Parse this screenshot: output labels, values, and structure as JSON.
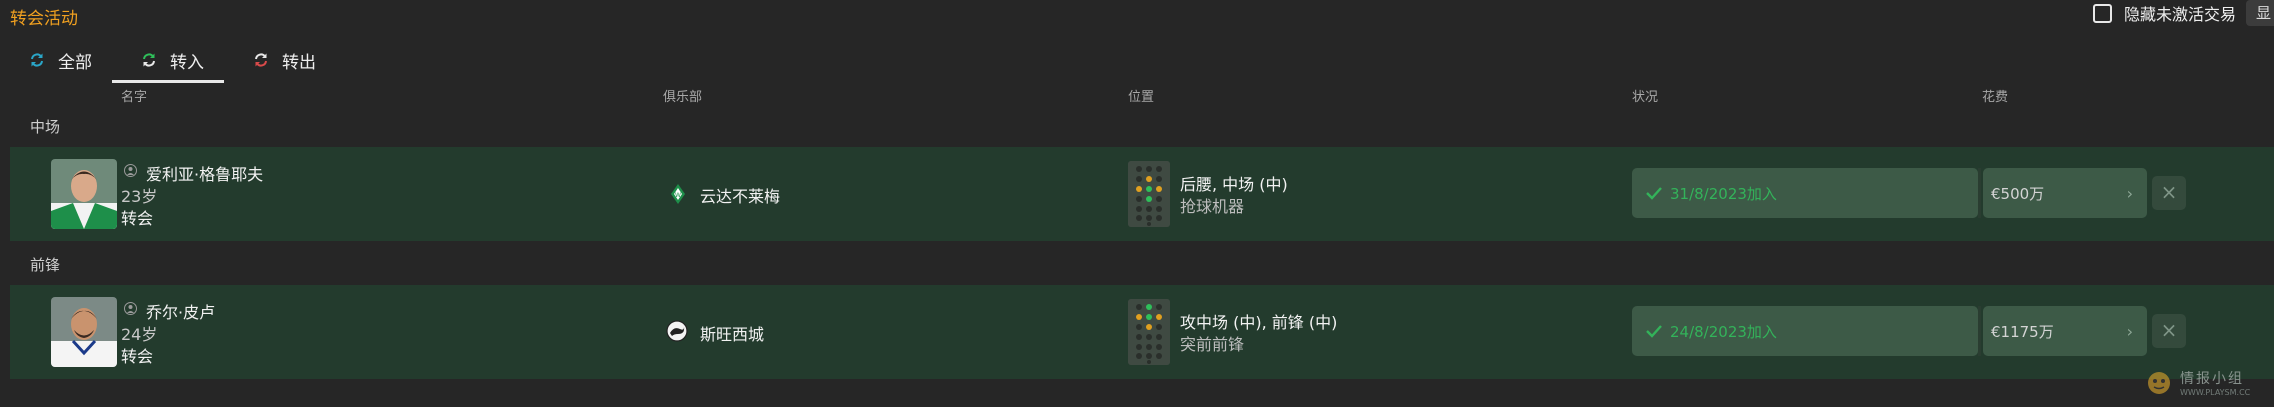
{
  "header": {
    "title": "转会活动",
    "hide_inactive_label": "隐藏未激活交易",
    "corner_button": "显"
  },
  "tabs": [
    {
      "label": "全部",
      "icon": "refresh-icon",
      "color": "#2aa6c8"
    },
    {
      "label": "转入",
      "icon": "transfer-in-icon",
      "color": "#2fbf5a"
    },
    {
      "label": "转出",
      "icon": "transfer-out-icon",
      "color": "#d94a4a"
    }
  ],
  "columns": {
    "name": "名字",
    "club": "俱乐部",
    "position": "位置",
    "status": "状况",
    "fee": "花费"
  },
  "groups": [
    {
      "label": "中场",
      "player": {
        "name": "爱利亚·格鲁耶夫",
        "age": "23岁",
        "type": "转会",
        "club": "云达不莱梅",
        "club_icon": "werder-crest-icon",
        "position": "后腰, 中场 (中)",
        "role": "抢球机器",
        "status": "31/8/2023加入",
        "fee": "€500万"
      }
    },
    {
      "label": "前锋",
      "player": {
        "name": "乔尔·皮卢",
        "age": "24岁",
        "type": "转会",
        "club": "斯旺西城",
        "club_icon": "swansea-crest-icon",
        "position": "攻中场 (中), 前锋 (中)",
        "role": "突前前锋",
        "status": "24/8/2023加入",
        "fee": "€1175万"
      }
    }
  ],
  "watermark": {
    "text": "情报小组",
    "sub": "WWW.PLAYSM.CC"
  },
  "colors": {
    "accent": "#f0a020",
    "row_bg": "#233b2d",
    "status_green": "#33b35a",
    "page_bg": "#262626"
  }
}
